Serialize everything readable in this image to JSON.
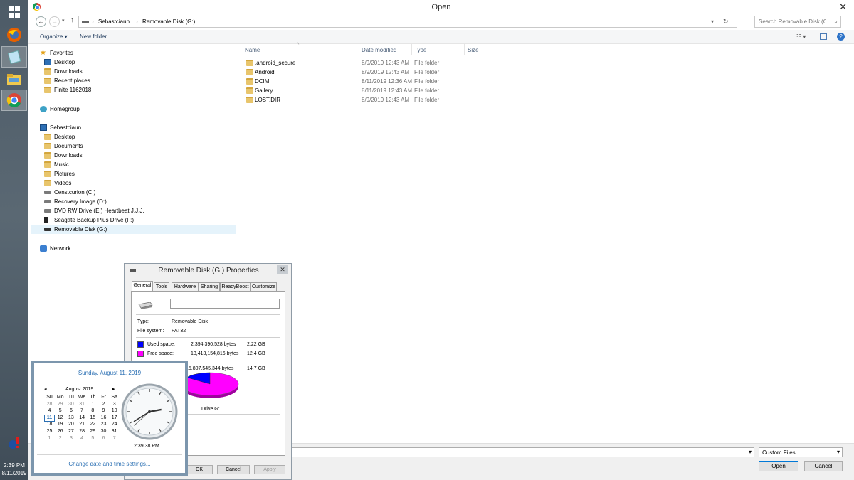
{
  "taskbar": {
    "apps": [
      {
        "name": "windows-start",
        "icon": "windows-logo-icon"
      },
      {
        "name": "firefox",
        "icon": "firefox-icon"
      },
      {
        "name": "notepad",
        "icon": "notepad-icon"
      },
      {
        "name": "file-explorer",
        "icon": "folder-icon"
      },
      {
        "name": "chrome",
        "icon": "chrome-icon"
      }
    ],
    "clock_time": "2:39 PM",
    "clock_date": "8/11/2019"
  },
  "dialog": {
    "title": "Open",
    "breadcrumb": [
      "Sebastciaun",
      "Removable Disk (G:)"
    ],
    "search_placeholder": "Search Removable Disk (G:)",
    "toolbar": {
      "organize": "Organize ▾",
      "new_folder": "New folder"
    },
    "nav": {
      "favorites_label": "Favorites",
      "favorites": [
        "Desktop",
        "Downloads",
        "Recent places",
        "Finite 1162018"
      ],
      "homegroup_label": "Homegroup",
      "pc_label": "Sebastciaun",
      "pc_items": [
        "Desktop",
        "Documents",
        "Downloads",
        "Music",
        "Pictures",
        "Videos",
        "Censtcurion (C:)",
        "Recovery Image (D:)",
        "DVD RW Drive (E:) Heartbeat J.J.J.",
        "Seagate Backup Plus Drive (F:)",
        "Removable Disk (G:)"
      ],
      "network_label": "Network"
    },
    "columns": {
      "name": "Name",
      "date": "Date modified",
      "type": "Type",
      "size": "Size"
    },
    "files": [
      {
        "name": ".android_secure",
        "date": "8/9/2019 12:43 AM",
        "type": "File folder"
      },
      {
        "name": "Android",
        "date": "8/9/2019 12:43 AM",
        "type": "File folder"
      },
      {
        "name": "DCIM",
        "date": "8/11/2019 12:36 AM",
        "type": "File folder"
      },
      {
        "name": "Gallery",
        "date": "8/11/2019 12:43 AM",
        "type": "File folder"
      },
      {
        "name": "LOST.DIR",
        "date": "8/9/2019 12:43 AM",
        "type": "File folder"
      }
    ],
    "filter": "Custom Files",
    "open_label": "Open",
    "cancel_label": "Cancel"
  },
  "properties": {
    "title": "Removable Disk (G:) Properties",
    "tabs": [
      "General",
      "Tools",
      "Hardware",
      "Sharing",
      "ReadyBoost",
      "Customize"
    ],
    "name_value": "",
    "type_label": "Type:",
    "type_value": "Removable Disk",
    "fs_label": "File system:",
    "fs_value": "FAT32",
    "used_label": "Used space:",
    "used_bytes": "2,394,390,528 bytes",
    "used_gb": "2.22 GB",
    "free_label": "Free space:",
    "free_bytes": "13,413,154,816 bytes",
    "free_gb": "12.4 GB",
    "capacity_bytes": "15,807,545,344 bytes",
    "capacity_gb": "14.7 GB",
    "drive_label": "Drive G:",
    "used_fraction": 0.1515,
    "used_color": "#0000ff",
    "free_color": "#ff00ff",
    "ok_label": "OK",
    "cancel_label": "Cancel",
    "apply_label": "Apply"
  },
  "calendar": {
    "long_date": "Sunday, August 11, 2019",
    "month_label": "August 2019",
    "weekdays": [
      "Su",
      "Mo",
      "Tu",
      "We",
      "Th",
      "Fr",
      "Sa"
    ],
    "weeks": [
      [
        "28",
        "29",
        "30",
        "31",
        "1",
        "2",
        "3"
      ],
      [
        "4",
        "5",
        "6",
        "7",
        "8",
        "9",
        "10"
      ],
      [
        "11",
        "12",
        "13",
        "14",
        "15",
        "16",
        "17"
      ],
      [
        "18",
        "19",
        "20",
        "21",
        "22",
        "23",
        "24"
      ],
      [
        "25",
        "26",
        "27",
        "28",
        "29",
        "30",
        "31"
      ],
      [
        "1",
        "2",
        "3",
        "4",
        "5",
        "6",
        "7"
      ]
    ],
    "time": "2:39:38 PM",
    "hour": 2,
    "minute": 39,
    "second": 38,
    "settings_link": "Change date and time settings..."
  }
}
